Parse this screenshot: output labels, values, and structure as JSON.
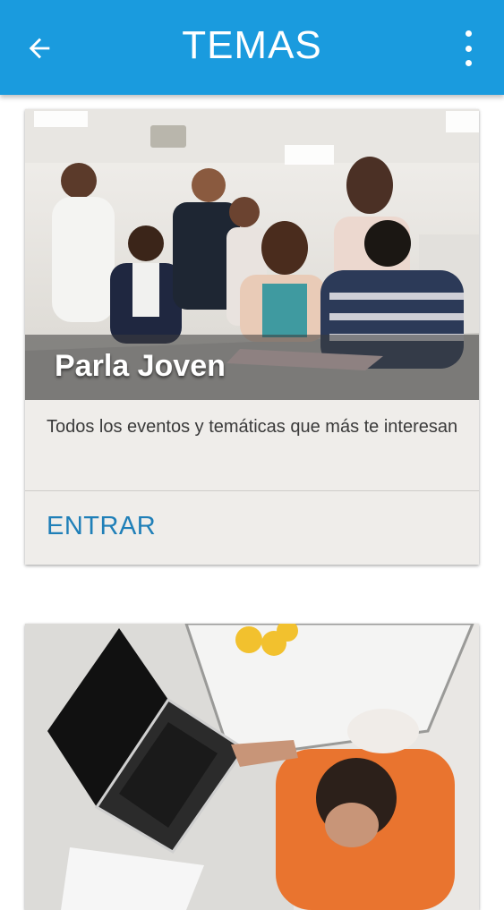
{
  "app_bar": {
    "title": "TEMAS",
    "back_icon": "arrow-back-icon",
    "menu_icon": "more-vert-icon",
    "color": "#1a9bde"
  },
  "cards": [
    {
      "caption": "Parla Joven",
      "description": "Todos los eventos y temáticas que más te interesan",
      "action_label": "ENTRAR",
      "image": "students-group-photo"
    },
    {
      "image": "person-laptop-photo"
    }
  ],
  "colors": {
    "accent": "#1f7fb8",
    "card_bg": "#efedea"
  }
}
